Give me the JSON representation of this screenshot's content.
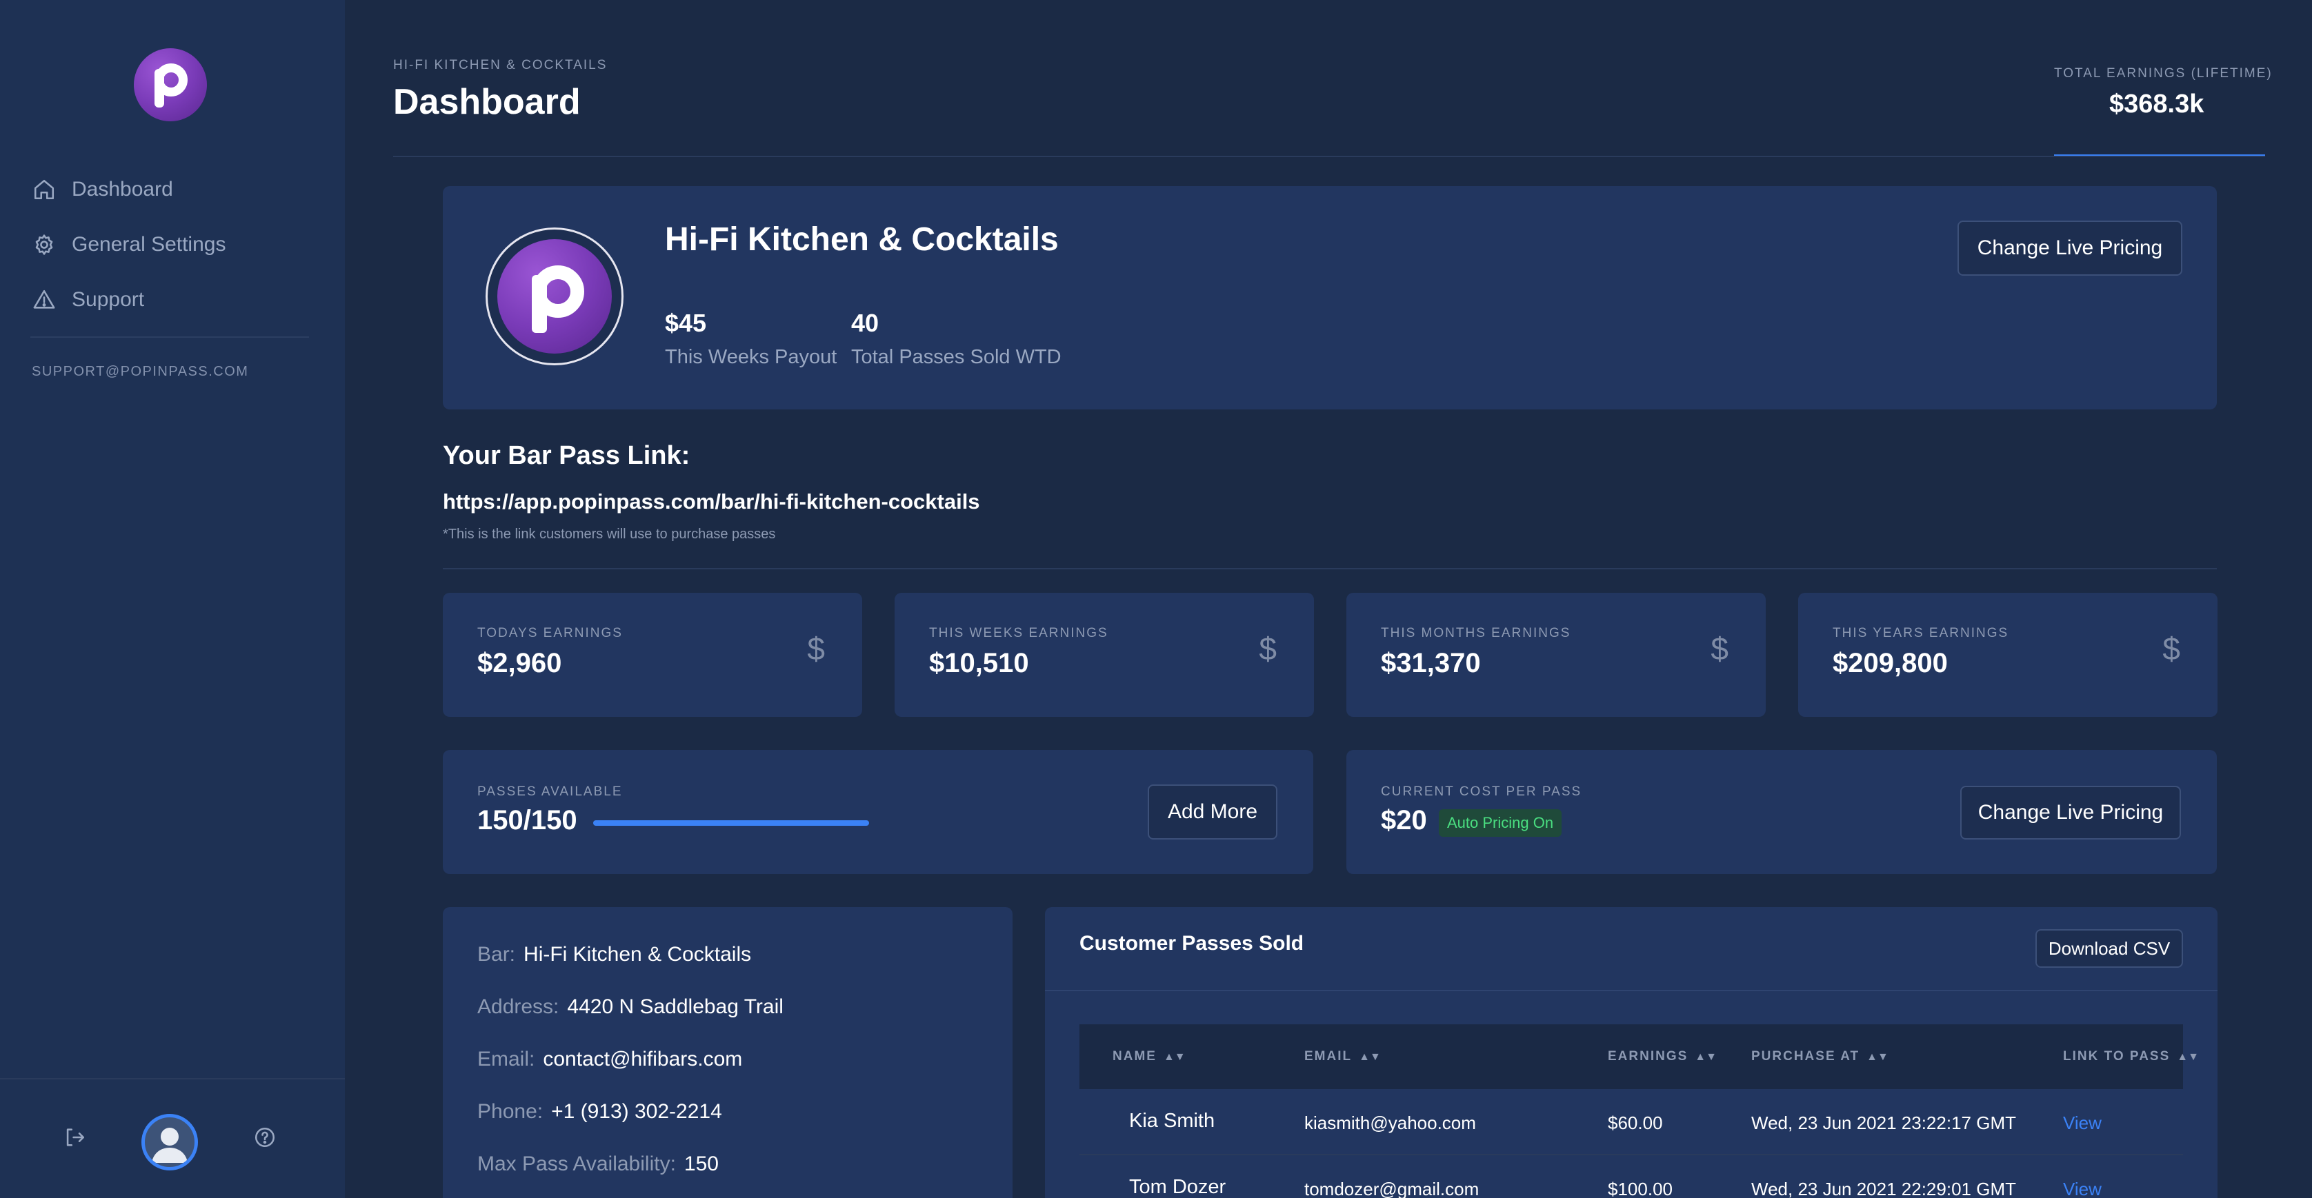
{
  "sidebar": {
    "nav": [
      {
        "label": "Dashboard",
        "icon": "home-icon"
      },
      {
        "label": "General Settings",
        "icon": "gear-icon"
      },
      {
        "label": "Support",
        "icon": "warning-icon"
      }
    ],
    "support_email": "SUPPORT@POPINPASS.COM"
  },
  "header": {
    "subtitle": "HI-FI KITCHEN & COCKTAILS",
    "title": "Dashboard",
    "total_label": "TOTAL EARNINGS (LIFETIME)",
    "total_value": "$368.3k"
  },
  "venue": {
    "name": "Hi-Fi Kitchen & Cocktails",
    "payout_value": "$45",
    "payout_label": "This Weeks Payout",
    "passes_value": "40",
    "passes_label": "Total Passes Sold WTD",
    "change_pricing_label": "Change Live Pricing"
  },
  "pass_link": {
    "heading": "Your Bar Pass Link:",
    "url": "https://app.popinpass.com/bar/hi-fi-kitchen-cocktails",
    "note": "*This is the link customers will use to purchase passes"
  },
  "earnings": [
    {
      "label": "TODAYS EARNINGS",
      "value": "$2,960"
    },
    {
      "label": "THIS WEEKS EARNINGS",
      "value": "$10,510"
    },
    {
      "label": "THIS MONTHS EARNINGS",
      "value": "$31,370"
    },
    {
      "label": "THIS YEARS EARNINGS",
      "value": "$209,800"
    }
  ],
  "currency_symbol": "$",
  "passes": {
    "label": "PASSES AVAILABLE",
    "value": "150/150",
    "fill_fraction": 1.0,
    "add_more_label": "Add More"
  },
  "cost": {
    "label": "CURRENT COST PER PASS",
    "value": "$20",
    "badge": "Auto Pricing On",
    "change_pricing_label": "Change Live Pricing"
  },
  "info": [
    {
      "key": "Bar:",
      "value": "Hi-Fi Kitchen & Cocktails"
    },
    {
      "key": "Address:",
      "value": "4420 N Saddlebag Trail"
    },
    {
      "key": "Email:",
      "value": "contact@hifibars.com"
    },
    {
      "key": "Phone:",
      "value": "+1 (913) 302-2214"
    },
    {
      "key": "Max Pass Availability:",
      "value": "150"
    }
  ],
  "table": {
    "title": "Customer Passes Sold",
    "download_label": "Download CSV",
    "headers": [
      "NAME",
      "EMAIL",
      "EARNINGS",
      "PURCHASE AT",
      "LINK TO PASS"
    ],
    "rows": [
      [
        "Kia Smith",
        "kiasmith@yahoo.com",
        "$60.00",
        "Wed, 23 Jun 2021 23:22:17 GMT",
        "View"
      ],
      [
        "Tom Dozer",
        "tomdozer@gmail.com",
        "$100.00",
        "Wed, 23 Jun 2021 22:29:01 GMT",
        "View"
      ]
    ]
  },
  "colors": {
    "accent": "#3b82f6",
    "brand_purple": "#7a3bb8",
    "badge_green": "#4ade80"
  }
}
